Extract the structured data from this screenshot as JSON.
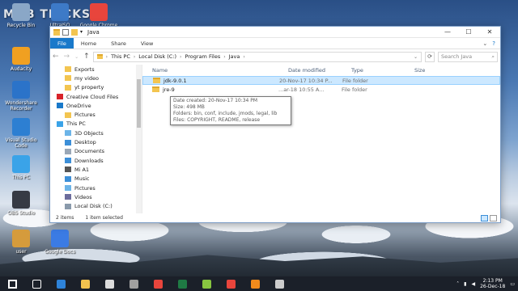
{
  "watermark": "MOB TRICKS",
  "desktop_icons": [
    {
      "label": "Recycle Bin",
      "color": "#8aa7c7"
    },
    {
      "label": "UltraISO",
      "color": "#3d7ac7"
    },
    {
      "label": "Google Chrome",
      "color": "#e8453c"
    },
    {
      "label": "Audacity",
      "color": "#f0a021"
    },
    {
      "label": "Wondershare Recorder",
      "color": "#2b73c9"
    },
    {
      "label": "Visual Studio Code",
      "color": "#2d7fd2"
    },
    {
      "label": "This PC",
      "color": "#3aa3e8"
    },
    {
      "label": "OBS Studio",
      "color": "#363a44"
    },
    {
      "label": "user",
      "color": "#d59b3c"
    },
    {
      "label": "Google Docs",
      "color": "#3b7be4"
    }
  ],
  "window": {
    "title": "Java",
    "ribbon_tabs": [
      "File",
      "Home",
      "Share",
      "View"
    ],
    "controls": {
      "minimize": "—",
      "maximize": "☐",
      "close": "✕"
    },
    "address": {
      "crumbs": [
        "This PC",
        "Local Disk (C:)",
        "Program Files",
        "Java"
      ],
      "search_placeholder": "Search Java"
    },
    "nav_items": [
      {
        "label": "Exports",
        "icon": "folder-icon",
        "indent": 2
      },
      {
        "label": "my video",
        "icon": "folder-icon",
        "indent": 2
      },
      {
        "label": "yt property",
        "icon": "folder-icon",
        "indent": 2
      },
      {
        "label": "Creative Cloud Files",
        "icon": "creative-cloud-icon",
        "indent": 1
      },
      {
        "label": "OneDrive",
        "icon": "onedrive-icon",
        "indent": 1
      },
      {
        "label": "Pictures",
        "icon": "folder-icon",
        "indent": 2
      },
      {
        "label": "This PC",
        "icon": "this-pc-icon",
        "indent": 1
      },
      {
        "label": "3D Objects",
        "icon": "3d-objects-icon",
        "indent": 2
      },
      {
        "label": "Desktop",
        "icon": "desktop-icon",
        "indent": 2
      },
      {
        "label": "Documents",
        "icon": "documents-icon",
        "indent": 2
      },
      {
        "label": "Downloads",
        "icon": "downloads-icon",
        "indent": 2
      },
      {
        "label": "Mi A1",
        "icon": "phone-icon",
        "indent": 2
      },
      {
        "label": "Music",
        "icon": "music-icon",
        "indent": 2
      },
      {
        "label": "Pictures",
        "icon": "pictures-icon",
        "indent": 2
      },
      {
        "label": "Videos",
        "icon": "videos-icon",
        "indent": 2
      },
      {
        "label": "Local Disk (C:)",
        "icon": "drive-icon",
        "indent": 2
      }
    ],
    "columns": [
      "Name",
      "Date modified",
      "Type",
      "Size"
    ],
    "files": [
      {
        "name": "jdk-9.0.1",
        "date": "20-Nov-17 10:34 P...",
        "type": "File folder",
        "size": "",
        "selected": true
      },
      {
        "name": "jre-9",
        "date": "...ar-18 10:55 A...",
        "type": "File folder",
        "size": "",
        "selected": false
      }
    ],
    "tooltip": [
      "Date created: 20-Nov-17 10:34 PM",
      "Size: 498 MB",
      "Folders: bin, conf, include, jmods, legal, lib",
      "Files: COPYRIGHT, README, release"
    ],
    "status": {
      "count": "2 items",
      "selection": "1 item selected"
    }
  },
  "taskbar": {
    "apps": [
      {
        "name": "start-button",
        "color": "#ffffff"
      },
      {
        "name": "task-view",
        "color": "#ffffff"
      },
      {
        "name": "edge",
        "color": "#2e83d9"
      },
      {
        "name": "file-explorer",
        "color": "#f2c24f"
      },
      {
        "name": "store",
        "color": "#dcdcdc"
      },
      {
        "name": "calculator",
        "color": "#a0a0a0"
      },
      {
        "name": "chrome",
        "color": "#e8453c"
      },
      {
        "name": "excel",
        "color": "#1f7a44"
      },
      {
        "name": "android-tool",
        "color": "#87c540"
      },
      {
        "name": "chrome-2",
        "color": "#e8453c"
      },
      {
        "name": "vlc",
        "color": "#f08a1c"
      },
      {
        "name": "obs",
        "color": "#cccccc"
      }
    ],
    "time": "2:13 PM",
    "date": "26-Dec-18"
  }
}
